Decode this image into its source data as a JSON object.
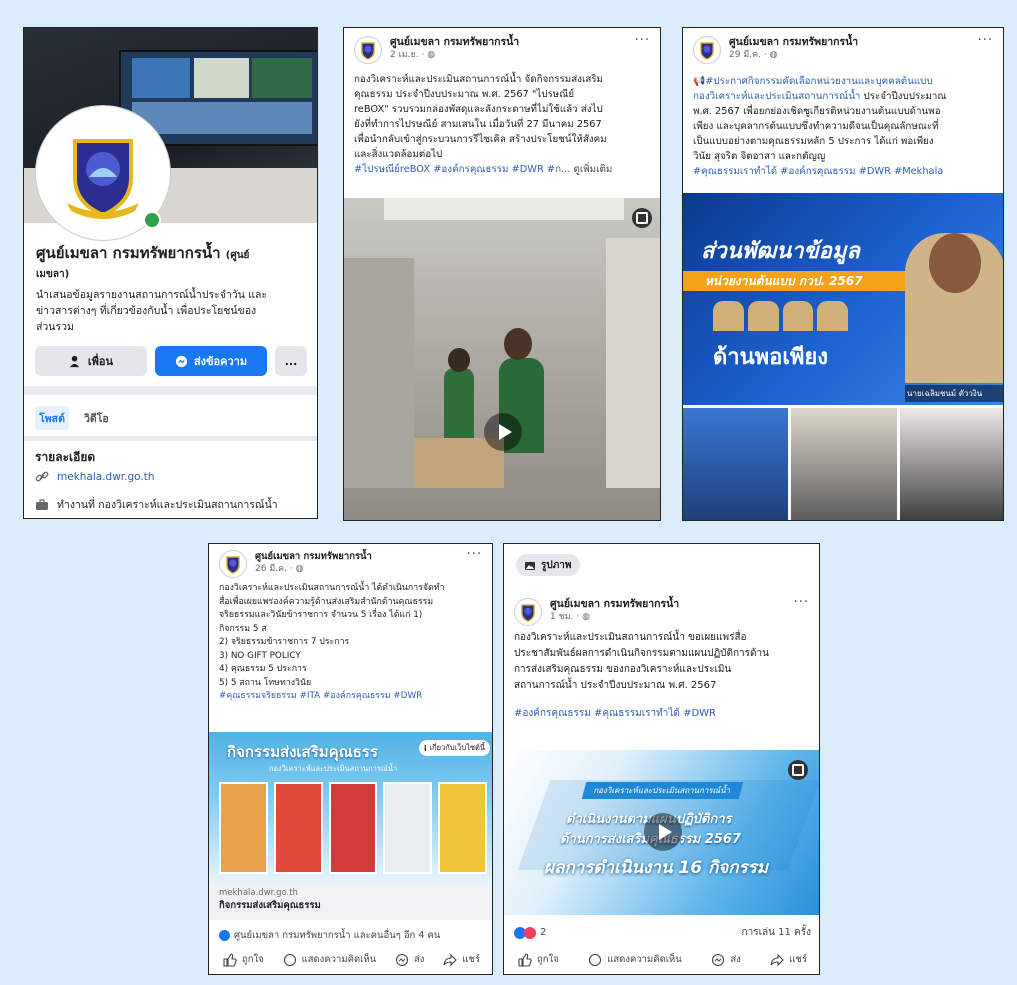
{
  "colors": {
    "background": "#d8ecf9",
    "facebook_blue": "#1877f2",
    "green_online": "#31a24c"
  },
  "page_name": "ศูนย์เมขลา กรมทรัพยากรน้ำ",
  "profile": {
    "name": "ศูนย์เมขลา กรมทรัพยากรน้ำ",
    "name_suffix": "(ศูนย์",
    "name_line2": "เมขลา)",
    "bio_line1": "นำเสนอข้อมูลรายงานสถานการณ์น้ำประจำวัน และ",
    "bio_line2": "ข่าวสารต่างๆ ที่เกี่ยวข้องกับน้ำ เพื่อประโยชน์ของ",
    "bio_line3": "ส่วนรวม",
    "friend_btn": "เพื่อน",
    "message_btn": "ส่งข้อความ",
    "more_btn": "...",
    "tab_posts": "โพสต์",
    "tab_videos": "วิดีโอ",
    "details_title": "รายละเอียด",
    "website": "mekhala.dwr.go.th",
    "work": "ทำงานที่ กองวิเคราะห์และประเมินสถานการณ์น้ำ"
  },
  "post1": {
    "date": "2 เม.ย. · ",
    "lines": [
      "กองวิเคราะห์และประเมินสถานการณ์น้ำ จัดกิจกรรมส่งเสริม",
      "คุณธรรม ประจำปีงบประมาณ พ.ศ. 2567 \"ไปรษณีย์",
      "reBOX\" รวบรวมกล่องพัสดุและลังกระดาษที่ไม่ใช้แล้ว ส่งไป",
      "ยังที่ทำการไปรษณีย์ สามเสนใน เมื่อวันที่ 27 มีนาคม 2567",
      "เพื่อนำกลับเข้าสู่กระบวนการรีไซเคิล สร้างประโยชน์ให้สังคม",
      "และสิ่งแวดล้อมต่อไป"
    ],
    "tags": "#ไปรษณีย์reBOX #องค์กรคุณธรรม #DWR #ก...",
    "see_more": "ดูเพิ่มเติม"
  },
  "post2": {
    "date": "29 มี.ค. · ",
    "lines_blue": [
      "#ประกาศกิจกรรมคัดเลือกหน่วยงานและบุคคลต้นแบบ",
      "กองวิเคราะห์และประเมินสถานการณ์น้ำ"
    ],
    "line2_rest": " ประจำปีงบประมาณ",
    "lines": [
      "พ.ศ. 2567 เพื่อยกย่องเชิดชูเกียรติหน่วยงานต้นแบบด้านพอ",
      "เพียง และบุคลากรต้นแบบซึ่งทำความดีจนเป็นคุณลักษณะที่",
      "เป็นแบบอย่างตามคุณธรรมหลัก 5 ประการ ได้แก่ พอเพียง",
      "วินัย สุจริต จิตอาสา และกตัญญู"
    ],
    "tags": "#คุณธรรมเราทำได้ #องค์กรคุณธรรม #DWR #Mekhala",
    "banner_title": "ส่วนพัฒนาข้อมูล",
    "banner_sub": "หน่วยงานต้นแบบ กวป. 2567",
    "banner_title2": "ด้านพอเพียง",
    "banner_caption": "นายเฉลิมชนม์ ตัววงิน"
  },
  "post3": {
    "date": "26 มี.ค. · ",
    "lines": [
      "กองวิเคราะห์และประเมินสถานการณ์น้ำ ได้ดำเนินการจัดทำ",
      "สื่อเพื่อเผยแพร่องค์ความรู้ด้านส่งเสริมสำนักด้านคุณธรรม",
      "จริยธรรมและวินัยข้าราชการ จำนวน 5 เรื่อง ได้แก่ 1)",
      "กิจกรรม 5 ส",
      "2) จริยธรรมข้าราชการ 7 ประการ",
      "3) NO GIFT POLICY",
      "4) คุณธรรม 5 ประการ",
      "5) 5 สถาน โทษทางวินัย"
    ],
    "tags": "#คุณธรรมจริยธรรม #ITA #องค์กรคุณธรรม #DWR",
    "banner_title": "กิจกรรมส่งเสริมคุณธรร",
    "banner_sub": "กองวิเคราะห์และประเมินสถานการณ์น้ำ",
    "info_badge": "เกี่ยวกับเว็บไซต์นี้",
    "link_domain": "mekhala.dwr.go.th",
    "link_title": "กิจกรรมส่งเสริมคุณธรรม",
    "reactions": "ศูนย์เมขลา กรมทรัพยากรน้ำ และคนอื่นๆ อีก 4 คน",
    "like": "ถูกใจ",
    "comment": "แสดงความคิดเห็น",
    "send": "ส่ง",
    "share": "แชร์"
  },
  "post4": {
    "album": "รูปภาพ",
    "date": "1 ชม. · ",
    "lines": [
      "กองวิเคราะห์และประเมินสถานการณ์น้ำ ขอเผยแพร่สื่อ",
      "ประชาสัมพันธ์ผลการดำเนินกิจกรรมตามแผนปฏิบัติการด้าน",
      "การส่งเสริมคุณธรรม ของกองวิเคราะห์และประเมิน",
      "สถานการณ์น้ำ ประจำปีงบประมาณ พ.ศ. 2567"
    ],
    "tags": "#องค์กรคุณธรรม #คุณธรรมเราทำได้  #DWR",
    "video_tag": "กองวิเคราะห์และประเมินสถานการณ์น้ำ",
    "video_line1": "ดำเนินงานตามแผนปฏิบัติการ",
    "video_line2": "ด้านการส่งเสริมคุณธรรม 2567",
    "video_line3": "ผลการดำเนินงาน 16 กิจกรรม",
    "reaction_count": "2",
    "plays": "การเล่น 11 ครั้ง",
    "like": "ถูกใจ",
    "comment": "แสดงความคิดเห็น",
    "send": "ส่ง",
    "share": "แชร์"
  }
}
